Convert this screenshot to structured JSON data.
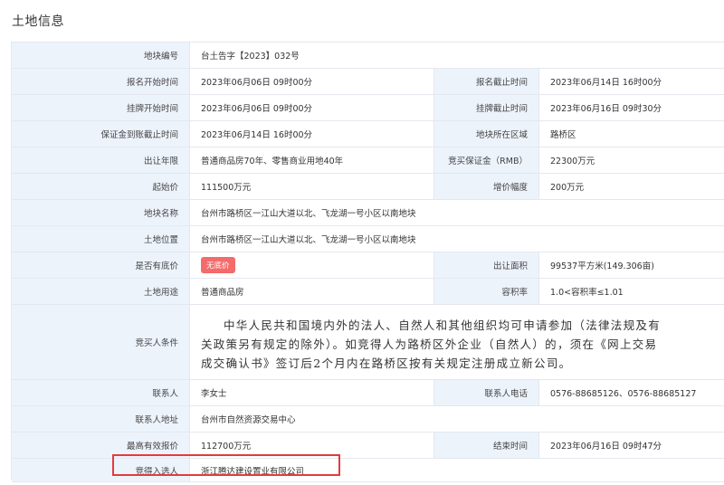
{
  "title": "土地信息",
  "rows": [
    {
      "l1": "地块编号",
      "v1": "台土告字【2023】032号",
      "wide": true
    },
    {
      "l1": "报名开始时间",
      "v1": "2023年06月06日 09时00分",
      "l2": "报名截止时间",
      "v2": "2023年06月14日 16时00分"
    },
    {
      "l1": "挂牌开始时间",
      "v1": "2023年06月06日 09时00分",
      "l2": "挂牌截止时间",
      "v2": "2023年06月16日 09时30分"
    },
    {
      "l1": "保证金到账截止时间",
      "v1": "2023年06月14日 16时00分",
      "l2": "地块所在区域",
      "v2": "路桥区"
    },
    {
      "l1": "出让年限",
      "v1": "普通商品房70年、零售商业用地40年",
      "l2": "竞买保证金（RMB）",
      "v2": "22300万元"
    },
    {
      "l1": "起始价",
      "v1": "111500万元",
      "l2": "增价幅度",
      "v2": "200万元"
    },
    {
      "l1": "地块名称",
      "v1": "台州市路桥区一江山大道以北、飞龙湖一号小区以南地块",
      "wide": true
    },
    {
      "l1": "土地位置",
      "v1": "台州市路桥区一江山大道以北、飞龙湖一号小区以南地块",
      "wide": true
    },
    {
      "l1": "是否有底价",
      "v1": "无底价",
      "l2": "出让面积",
      "v2": "99537平方米(149.306亩)"
    },
    {
      "l1": "土地用途",
      "v1": "普通商品房",
      "l2": "容积率",
      "v2": "1.0<容积率≤1.01"
    },
    {
      "l1": "竞买人条件",
      "v1_lines": [
        "中华人民共和国境内外的法人、自然人和其他组织均可申请参加（法律法规及有",
        "关政策另有规定的除外）。如竞得人为路桥区外企业（自然人）的，须在《网上交易",
        "成交确认书》签订后2个月内在路桥区按有关规定注册成立新公司。"
      ],
      "wide": true
    },
    {
      "l1": "联系人",
      "v1": "李女士",
      "l2": "联系人电话",
      "v2": "0576-88685126、0576-88685127"
    },
    {
      "l1": "联系人地址",
      "v1": "台州市自然资源交易中心",
      "wide": true
    },
    {
      "l1": "最高有效报价",
      "v1": "112700万元",
      "l2": "结束时间",
      "v2": "2023年06月16日 09时47分"
    },
    {
      "l1": "竞得入选人",
      "v1": "浙江腾达建设置业有限公司",
      "wide": true
    }
  ]
}
